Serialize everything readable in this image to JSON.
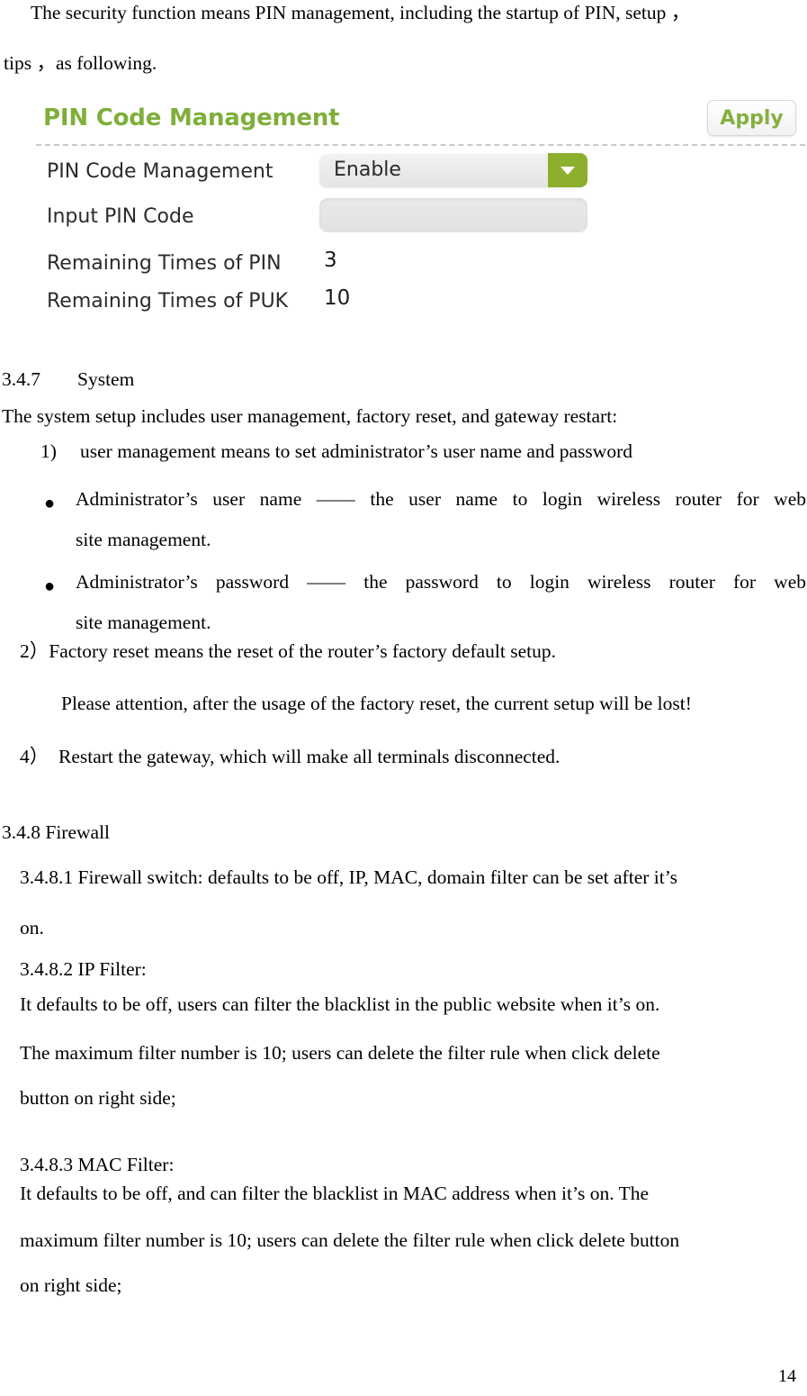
{
  "document": {
    "page_number": "14",
    "intro_line1": "The security function means PIN management, including the startup of PIN, setup ，",
    "intro_line2": "tips ，as following."
  },
  "pin_panel": {
    "title": "PIN Code Management",
    "apply_label": "Apply",
    "accent_color": "#7FAF3B",
    "arrow_button_color": "#8CAF2C",
    "rows": [
      {
        "label": "PIN Code Management",
        "type": "select",
        "value": "Enable"
      },
      {
        "label": "Input PIN Code",
        "type": "input",
        "value": ""
      },
      {
        "label": "Remaining Times of PIN",
        "type": "text",
        "value": "3"
      },
      {
        "label": "Remaining Times of PUK",
        "type": "text",
        "value": "10"
      }
    ]
  },
  "sections": {
    "s347_number": "3.4.7",
    "s347_title": "System",
    "s347_intro": "The system setup includes user management, factory reset, and gateway restart:",
    "item1_marker": "1)",
    "item1_text": "user management means to set administrator’s user name and password",
    "bullet1_line1": "Administrator’s user name —— the user name to login wireless router for web",
    "bullet1_line2": "site management.",
    "bullet2_line1": "Administrator’s password —— the password to login wireless router for web",
    "bullet2_line2": "site management.",
    "item2_text": "2）Factory reset means the reset of the router’s factory default setup.",
    "item2_note": "Please attention, after the usage of the factory reset, the current setup will be lost!",
    "item4_text": "4）　Restart the gateway, which will make all terminals disconnected.",
    "s348_title": "3.4.8 Firewall",
    "s3481_line1": "3.4.8.1 Firewall switch: defaults to be off, IP, MAC, domain filter can be set after it’s",
    "s3481_line2": "on.",
    "s3482_title": "3.4.8.2 IP Filter:",
    "s3482_line1": "It defaults to be off, users can filter the blacklist in the public website when it’s on.",
    "s3482_line2": "The maximum filter number is 10; users can delete the filter rule when click delete",
    "s3482_line3": "button on right side;",
    "s3483_title": "3.4.8.3 MAC Filter:",
    "s3483_line1": "It defaults to be off, and can filter the blacklist in MAC address when it’s on. The",
    "s3483_line2": "maximum filter number is 10; users can delete the filter rule when click delete button",
    "s3483_line3": "on right side;"
  }
}
